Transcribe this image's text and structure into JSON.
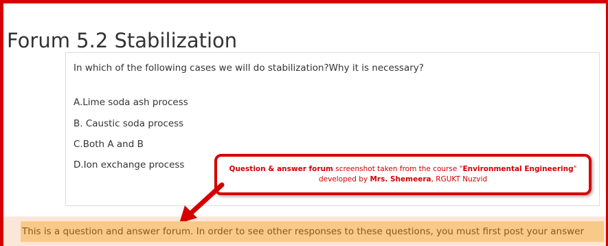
{
  "page": {
    "title": "Forum 5.2 Stabilization"
  },
  "question": {
    "text": "In which of the following cases we will do stabilization?Why it is necessary?",
    "options": [
      "A.Lime soda ash process",
      "B. Caustic soda process",
      "C.Both A and B",
      "D.Ion exchange process"
    ]
  },
  "callout": {
    "part1_bold": "Question & answer forum",
    "part2": " screenshot taken from the course \"",
    "part3_bold": "Environmental Engineering",
    "part4": "\" developed by ",
    "part5_bold": "Mrs. Shemeera",
    "part6": ", RGUKT Nuzvid"
  },
  "notice": {
    "text": "This is a question and answer forum. In order to see other responses to these questions, you must first post your answer"
  },
  "colors": {
    "frame": "#d40000",
    "notice_bg": "#f9c98a",
    "notice_text": "#8a5a1a"
  }
}
